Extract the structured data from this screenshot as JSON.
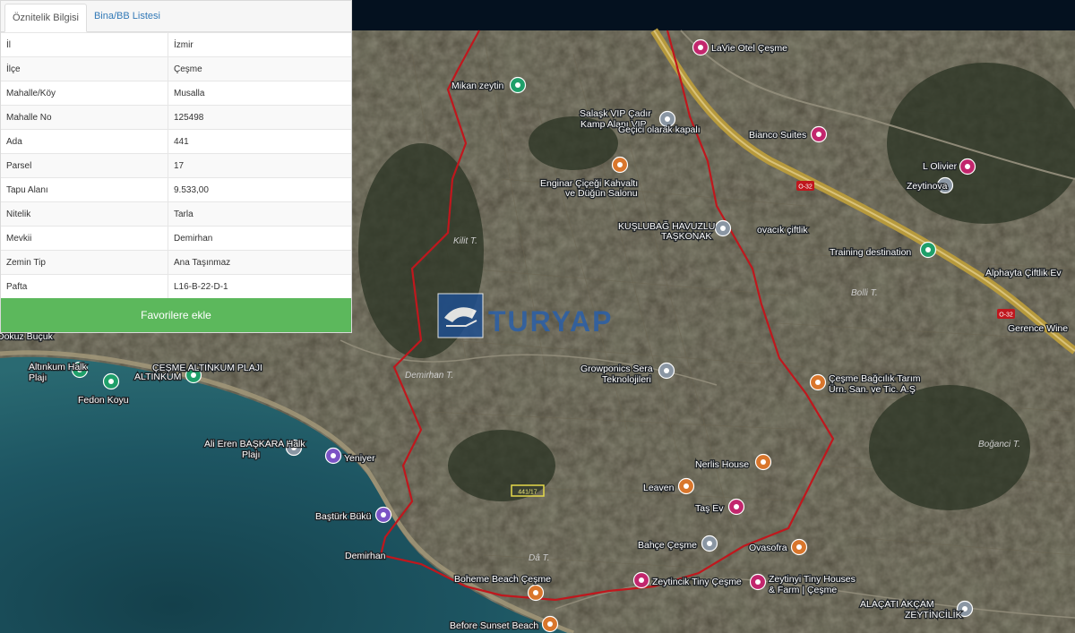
{
  "panel": {
    "tabs": [
      "Öznitelik Bilgisi",
      "Bina/BB Listesi"
    ],
    "rows": [
      {
        "key": "İl",
        "value": "İzmir"
      },
      {
        "key": "İlçe",
        "value": "Çeşme"
      },
      {
        "key": "Mahalle/Köy",
        "value": "Musalla"
      },
      {
        "key": "Mahalle No",
        "value": "125498"
      },
      {
        "key": "Ada",
        "value": "441"
      },
      {
        "key": "Parsel",
        "value": "17"
      },
      {
        "key": "Tapu Alanı",
        "value": "9.533,00"
      },
      {
        "key": "Nitelik",
        "value": "Tarla"
      },
      {
        "key": "Mevkii",
        "value": "Demirhan"
      },
      {
        "key": "Zemin Tip",
        "value": "Ana Taşınmaz"
      },
      {
        "key": "Pafta",
        "value": "L16-B-22-D-1"
      }
    ],
    "favorite_button": "Favorilere ekle"
  },
  "watermark": "TURYAP",
  "parcel_label": "441/17",
  "colors": {
    "boundary": "#c0171d",
    "road": "#b79a3d",
    "sea": "#1d5562",
    "land": "#4a4538",
    "pin_pink": "#c2266d",
    "pin_orange": "#d9762c",
    "pin_gray": "#8a96a3",
    "pin_green": "#1f9f6a",
    "pin_purple": "#7b53c5",
    "accent_green": "#5cb85c"
  },
  "map": {
    "places": [
      {
        "name": "LaVie Otel Çeşme",
        "icon": "hotel-icon",
        "color": "pink"
      },
      {
        "name": "Mikan zeytin",
        "icon": "leaf-icon",
        "color": "green"
      },
      {
        "name": "Salaşk VIP Çadır Kamp Alanı VIP",
        "icon": "camp-icon",
        "color": "gray"
      },
      {
        "name": "Geçici olarak kapalı",
        "icon": "",
        "color": ""
      },
      {
        "name": "Bianco Suites",
        "icon": "hotel-icon",
        "color": "pink"
      },
      {
        "name": "Enginar Çiçeği Kahvaltı ve Düğün Salonu",
        "icon": "restaurant-icon",
        "color": "orange"
      },
      {
        "name": "L Olivier",
        "icon": "hotel-icon",
        "color": "pink"
      },
      {
        "name": "Zeytinova",
        "icon": "place-icon",
        "color": "gray"
      },
      {
        "name": "KUŞLUBAĞ HAVUZLU TAŞKONAK",
        "icon": "place-icon",
        "color": "gray"
      },
      {
        "name": "ovacık çiftlik",
        "icon": "place-icon",
        "color": "gray"
      },
      {
        "name": "Training destination",
        "icon": "place-icon",
        "color": "green"
      },
      {
        "name": "Alphayta Çiftlik Ev",
        "icon": "",
        "color": ""
      },
      {
        "name": "Gerence Wine",
        "icon": "",
        "color": ""
      },
      {
        "name": "Growponics Sera Teknolojileri",
        "icon": "place-icon",
        "color": "gray"
      },
      {
        "name": "Çeşme Bağcılık Tarım Ürn. San. ve Tic. A.Ş",
        "icon": "restaurant-icon",
        "color": "orange"
      },
      {
        "name": "Dokuz Buçuk",
        "icon": "",
        "color": ""
      },
      {
        "name": "Altınkum Halk Plajı",
        "icon": "beach-icon",
        "color": "green"
      },
      {
        "name": "ÇEŞME ALTINKUM PLAJI",
        "icon": "beach-icon",
        "color": "green"
      },
      {
        "name": "Fedon Koyu",
        "icon": "beach-icon",
        "color": "green"
      },
      {
        "name": "Ali Eren BAŞKARA Halk Plajı",
        "icon": "place-icon",
        "color": "gray"
      },
      {
        "name": "Yeniyer",
        "icon": "camera-icon",
        "color": "purple"
      },
      {
        "name": "Baştürk Bükü",
        "icon": "camera-icon",
        "color": "purple"
      },
      {
        "name": "Nerlis House",
        "icon": "restaurant-icon",
        "color": "orange"
      },
      {
        "name": "Leaven",
        "icon": "restaurant-icon",
        "color": "orange"
      },
      {
        "name": "Taş Ev",
        "icon": "hotel-icon",
        "color": "pink"
      },
      {
        "name": "Bahçe Çeşme",
        "icon": "place-icon",
        "color": "gray"
      },
      {
        "name": "Ovasofra",
        "icon": "restaurant-icon",
        "color": "orange"
      },
      {
        "name": "Demirhan",
        "icon": "",
        "color": ""
      },
      {
        "name": "Boheme Beach Çeşme",
        "icon": "restaurant-icon",
        "color": "orange"
      },
      {
        "name": "Zeytincik Tiny Çeşme",
        "icon": "hotel-icon",
        "color": "pink"
      },
      {
        "name": "Zeytinyi Tiny Houses & Farm | Çeşme",
        "icon": "hotel-icon",
        "color": "pink"
      },
      {
        "name": "Before Sunset Beach",
        "icon": "restaurant-icon",
        "color": "orange"
      },
      {
        "name": "ALAÇATI AKÇAM ZEYTİNCİLİK",
        "icon": "place-icon",
        "color": "gray"
      }
    ],
    "area_labels": [
      "Kilit T.",
      "Demirhan T.",
      "Dâ T.",
      "Bolli T.",
      "Boğanci T."
    ],
    "road_labels": [
      "O-32",
      "O-32"
    ]
  }
}
